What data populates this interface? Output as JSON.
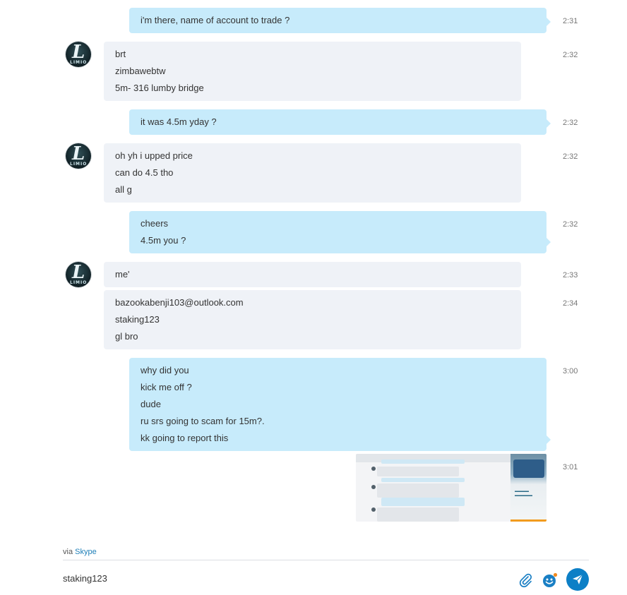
{
  "messages": [
    {
      "time": "2:31",
      "lines": [
        "i'm there, name of account to trade ?"
      ]
    },
    {
      "time": "2:32",
      "lines": [
        "brt",
        "zimbawebtw",
        "5m- 316 lumby bridge"
      ]
    },
    {
      "time": "2:32",
      "lines": [
        "it was 4.5m yday ?"
      ]
    },
    {
      "time": "2:32",
      "lines": [
        "oh yh i upped price",
        "can do 4.5 tho",
        "all g"
      ]
    },
    {
      "time": "2:32",
      "lines": [
        "cheers",
        "4.5m you ?"
      ]
    },
    {
      "time": "2:33",
      "lines": [
        "me'"
      ]
    },
    {
      "time": "2:34",
      "lines": [
        "bazookabenji103@outlook.com",
        "staking123",
        "gl bro"
      ]
    },
    {
      "time": "3:00",
      "lines": [
        "why did you",
        "kick me off ?",
        "dude",
        "ru srs going to scam for 15m?.",
        "kk going to report this"
      ]
    },
    {
      "time": "3:01"
    }
  ],
  "avatar": {
    "letter": "L",
    "word": "LIMIO"
  },
  "footer": {
    "via_prefix": "via",
    "via_service": "Skype"
  },
  "composer": {
    "text": "staking123"
  },
  "icons": {
    "attach": "paperclip-icon",
    "emoji": "emoji-icon",
    "send": "send-icon"
  },
  "colors": {
    "incoming_bubble": "#eff2f7",
    "outgoing_bubble": "#c7ebfb",
    "link": "#1e7fb8",
    "send_button": "#0c7fc6"
  }
}
